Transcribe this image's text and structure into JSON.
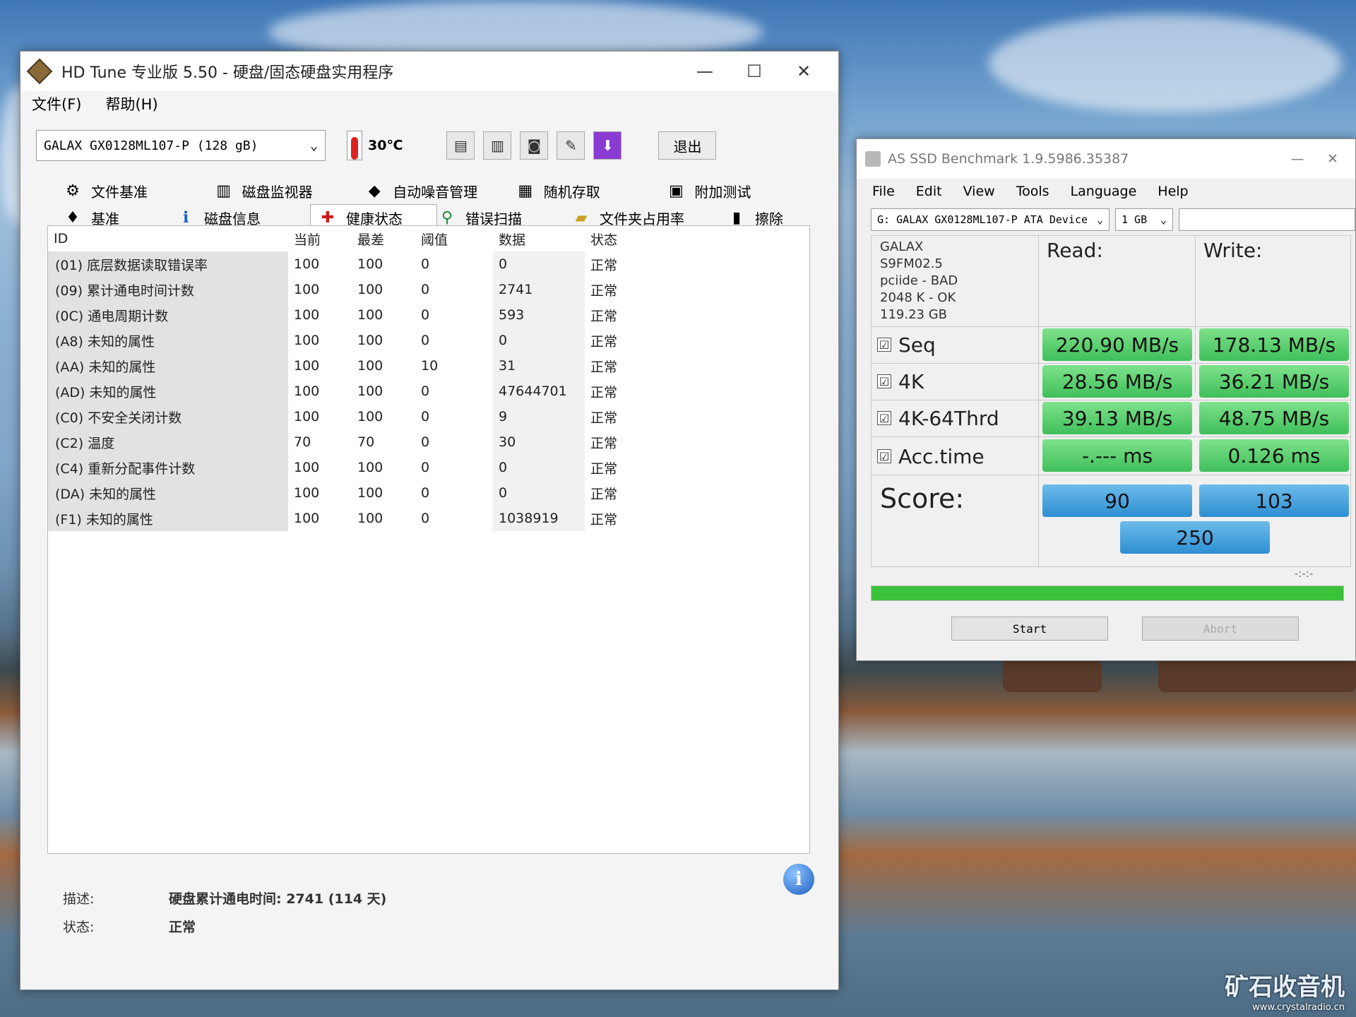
{
  "hdtune": {
    "title": "HD Tune 专业版 5.50 - 硬盘/固态硬盘实用程序",
    "window_buttons": [
      "—",
      "☐",
      "✕"
    ],
    "menu": [
      "文件(F)",
      "帮助(H)"
    ],
    "drive": "GALAX GX0128ML107-P (128 gB)",
    "temperature": "30℃",
    "exit_label": "退出",
    "tabs_row1": [
      "文件基准",
      "磁盘监视器",
      "自动噪音管理",
      "随机存取",
      "附加测试"
    ],
    "tabs_row2": [
      "基准",
      "磁盘信息",
      "健康状态",
      "错误扫描",
      "文件夹占用率",
      "擦除"
    ],
    "table": {
      "headers": [
        "ID",
        "当前",
        "最差",
        "阈值",
        "数据",
        "状态"
      ],
      "rows": [
        [
          "(01) 底层数据读取错误率",
          "100",
          "100",
          "0",
          "0",
          "正常"
        ],
        [
          "(09) 累计通电时间计数",
          "100",
          "100",
          "0",
          "2741",
          "正常"
        ],
        [
          "(0C) 通电周期计数",
          "100",
          "100",
          "0",
          "593",
          "正常"
        ],
        [
          "(A8) 未知的属性",
          "100",
          "100",
          "0",
          "0",
          "正常"
        ],
        [
          "(AA) 未知的属性",
          "100",
          "100",
          "10",
          "31",
          "正常"
        ],
        [
          "(AD) 未知的属性",
          "100",
          "100",
          "0",
          "47644701",
          "正常"
        ],
        [
          "(C0) 不安全关闭计数",
          "100",
          "100",
          "0",
          "9",
          "正常"
        ],
        [
          "(C2) 温度",
          "70",
          "70",
          "0",
          "30",
          "正常"
        ],
        [
          "(C4) 重新分配事件计数",
          "100",
          "100",
          "0",
          "0",
          "正常"
        ],
        [
          "(DA) 未知的属性",
          "100",
          "100",
          "0",
          "0",
          "正常"
        ],
        [
          "(F1) 未知的属性",
          "100",
          "100",
          "0",
          "1038919",
          "正常"
        ]
      ]
    },
    "description_label": "描述:",
    "description_value": "硬盘累计通电时间: 2741 (114 天)",
    "status_label": "状态:",
    "status_value": "正常"
  },
  "asssd": {
    "title": "AS SSD Benchmark 1.9.5986.35387",
    "close": "✕",
    "minimize": "—",
    "menu": [
      "File",
      "Edit",
      "View",
      "Tools",
      "Language",
      "Help"
    ],
    "drive": "G: GALAX GX0128ML107-P ATA Device",
    "size": "1 GB",
    "info": [
      "GALAX",
      "S9FM02.5",
      "pciide - BAD",
      "2048 K - OK",
      "119.23 GB"
    ],
    "read_header": "Read:",
    "write_header": "Write:",
    "checkmark": "☑",
    "tests": [
      {
        "name": "Seq",
        "read": "220.90 MB/s",
        "write": "178.13 MB/s"
      },
      {
        "name": "4K",
        "read": "28.56 MB/s",
        "write": "36.21 MB/s"
      },
      {
        "name": "4K-64Thrd",
        "read": "39.13 MB/s",
        "write": "48.75 MB/s"
      },
      {
        "name": "Acc.time",
        "read": "-.--- ms",
        "write": "0.126 ms"
      }
    ],
    "score_label": "Score:",
    "score_read": "90",
    "score_write": "103",
    "score_total": "250",
    "elapsed": "-:-:-",
    "progress": 1.0,
    "start_label": "Start",
    "abort_label": "Abort"
  },
  "watermark": {
    "text": "矿石收音机",
    "url": "www.crystalradio.cn"
  }
}
